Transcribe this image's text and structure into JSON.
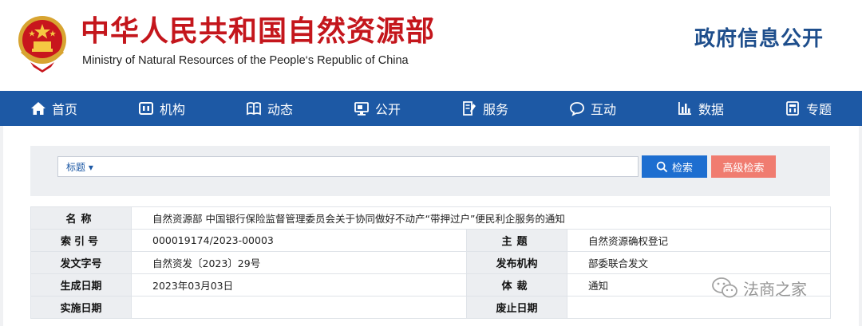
{
  "header": {
    "site_title_cn": "中华人民共和国自然资源部",
    "site_title_en": "Ministry of Natural Resources of the People‘s Republic of China",
    "gov_open": "政府信息公开"
  },
  "nav": {
    "items": [
      {
        "label": "首页",
        "icon": "home-icon"
      },
      {
        "label": "机构",
        "icon": "org-icon"
      },
      {
        "label": "动态",
        "icon": "book-icon"
      },
      {
        "label": "公开",
        "icon": "monitor-icon"
      },
      {
        "label": "服务",
        "icon": "document-edit-icon"
      },
      {
        "label": "互动",
        "icon": "chat-icon"
      },
      {
        "label": "数据",
        "icon": "bar-chart-icon"
      },
      {
        "label": "专题",
        "icon": "topic-icon"
      }
    ]
  },
  "search": {
    "type_label": "标题",
    "type_arrow": "▾",
    "value": "",
    "search_button": "检索",
    "advanced_button": "高级检索"
  },
  "info": {
    "name_label": "名称",
    "name_value": "自然资源部 中国银行保险监督管理委员会关于协同做好不动产“带押过户”便民利企服务的通知",
    "index_label": "索引号",
    "index_value": "000019174/2023-00003",
    "subject_label": "主题",
    "subject_value": "自然资源确权登记",
    "docno_label": "发文字号",
    "docno_value": "自然资发〔2023〕29号",
    "publisher_label": "发布机构",
    "publisher_value": "部委联合发文",
    "created_label": "生成日期",
    "created_value": "2023年03月03日",
    "genre_label": "体裁",
    "genre_value": "通知",
    "effective_label": "实施日期",
    "effective_value": "",
    "expiry_label": "废止日期",
    "expiry_value": ""
  },
  "watermark": {
    "text": "法商之家"
  },
  "colors": {
    "brand_red": "#c4161c",
    "nav_blue": "#1d59a5",
    "search_blue": "#1d6ed0",
    "advanced_salmon": "#f07c70"
  }
}
